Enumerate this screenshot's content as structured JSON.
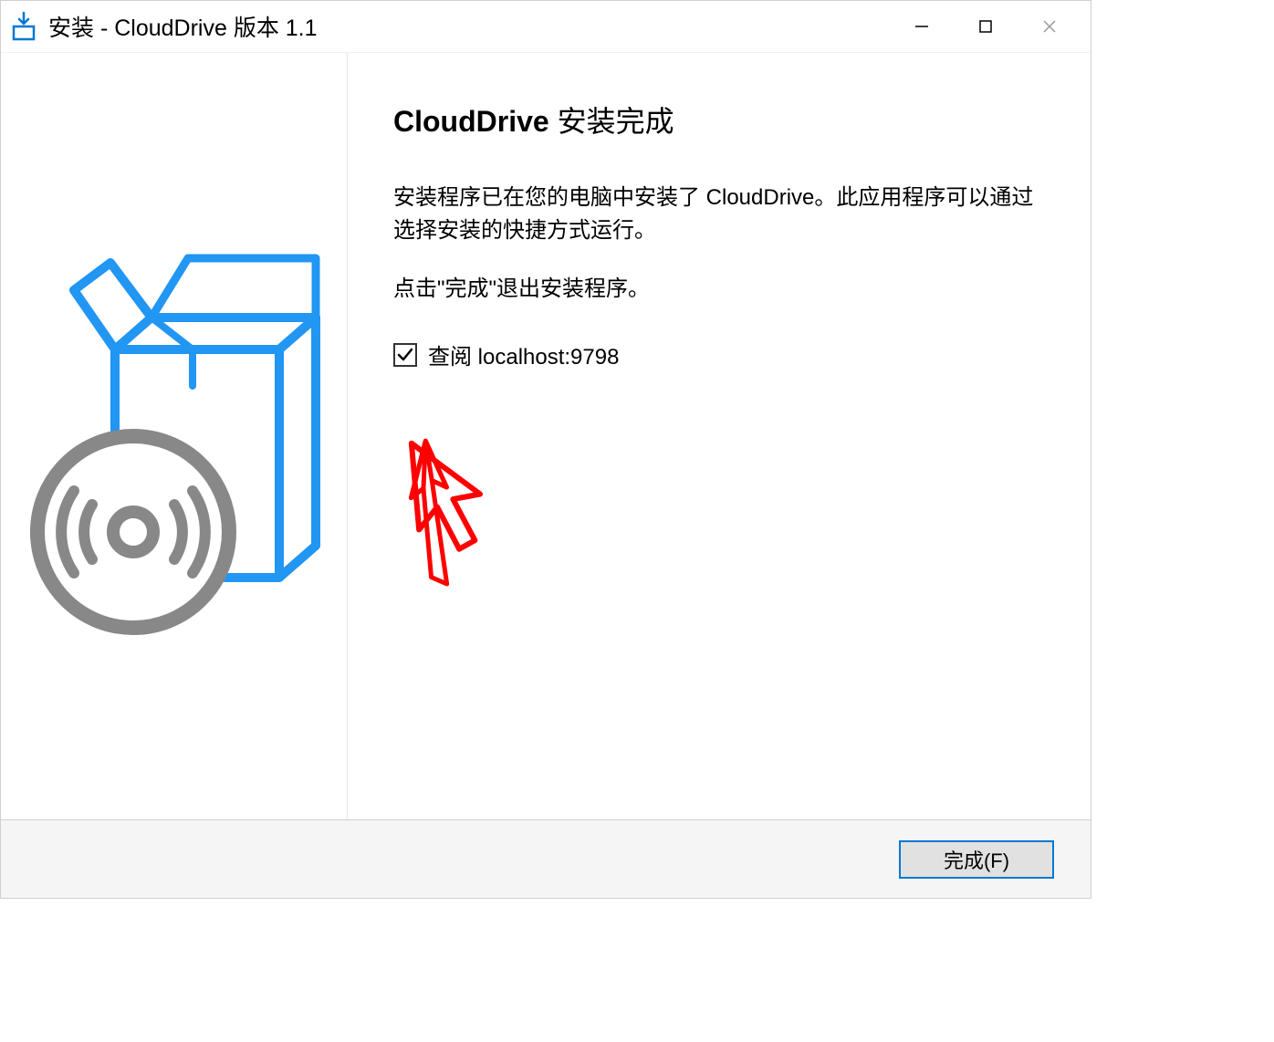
{
  "titlebar": {
    "title": "安装 - CloudDrive 版本 1.1"
  },
  "main": {
    "heading_bold": "CloudDrive",
    "heading_normal": " 安装完成",
    "paragraph1": "安装程序已在您的电脑中安装了 CloudDrive。此应用程序可以通过选择安装的快捷方式运行。",
    "paragraph2": "点击\"完成\"退出安装程序。",
    "checkbox_label": "查阅 localhost:9798",
    "checkbox_checked": true
  },
  "footer": {
    "finish_label": "完成(F)"
  }
}
